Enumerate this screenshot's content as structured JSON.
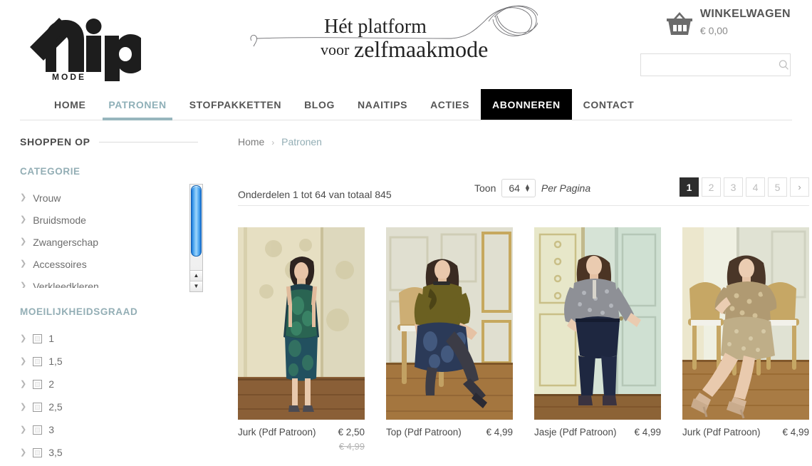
{
  "header": {
    "logo_text": "knip",
    "logo_sub": "MODE",
    "tagline_line1": "Hét platform",
    "tagline_line2": "voor zelfmaakmode",
    "cart_label": "WINKELWAGEN",
    "cart_total": "€ 0,00",
    "cart_icon": "basket-icon",
    "search_placeholder": "",
    "search_value": "",
    "search_icon": "search-icon"
  },
  "nav": {
    "items": [
      {
        "label": "HOME",
        "state": "default"
      },
      {
        "label": "PATRONEN",
        "state": "active"
      },
      {
        "label": "STOFPAKKETTEN",
        "state": "default"
      },
      {
        "label": "BLOG",
        "state": "default"
      },
      {
        "label": "NAAITIPS",
        "state": "default"
      },
      {
        "label": "ACTIES",
        "state": "default"
      },
      {
        "label": "ABONNEREN",
        "state": "highlight"
      },
      {
        "label": "CONTACT",
        "state": "default"
      }
    ]
  },
  "sidebar": {
    "title": "SHOPPEN OP",
    "groups": [
      {
        "title": "CATEGORIE",
        "items": [
          {
            "label": "Vrouw"
          },
          {
            "label": "Bruidsmode"
          },
          {
            "label": "Zwangerschap"
          },
          {
            "label": "Accessoires"
          },
          {
            "label": "Verkleedkleren"
          }
        ]
      },
      {
        "title": "MOEILIJKHEIDSGRAAD",
        "items": [
          {
            "label": "1"
          },
          {
            "label": "1,5"
          },
          {
            "label": "2"
          },
          {
            "label": "2,5"
          },
          {
            "label": "3"
          },
          {
            "label": "3,5"
          }
        ]
      }
    ],
    "scrollbar": {
      "up_arrow": "▲",
      "down_arrow": "▼"
    }
  },
  "breadcrumb": {
    "home": "Home",
    "separator": "›",
    "current": "Patronen"
  },
  "toolbar": {
    "amount": "Onderdelen 1 tot 64 van totaal 845",
    "show_label": "Toon",
    "per_page_value": "64",
    "per_page_label": "Per Pagina",
    "pages": [
      "1",
      "2",
      "3",
      "4",
      "5"
    ],
    "current_page": "1",
    "next_label": "›"
  },
  "products": [
    {
      "name": "Jurk (Pdf Patroon)",
      "price": "€ 2,50",
      "old_price": "€ 4,99",
      "image_alt": "model-in-teal-patterned-dress"
    },
    {
      "name": "Top (Pdf Patroon)",
      "price": "€ 4,99",
      "old_price": "",
      "image_alt": "seated-model-olive-top-blue-skirt"
    },
    {
      "name": "Jasje (Pdf Patroon)",
      "price": "€ 4,99",
      "old_price": "",
      "image_alt": "model-silver-jacket-navy-trousers"
    },
    {
      "name": "Jurk (Pdf Patroon)",
      "price": "€ 4,99",
      "old_price": "",
      "image_alt": "seated-model-gold-sequin-dress"
    }
  ],
  "colors": {
    "accent_teal": "#93aeb5",
    "nav_active_bar": "#97b6bd",
    "highlight_bg": "#000000",
    "text": "#4a4a4a",
    "muted": "#b5b5b5"
  }
}
